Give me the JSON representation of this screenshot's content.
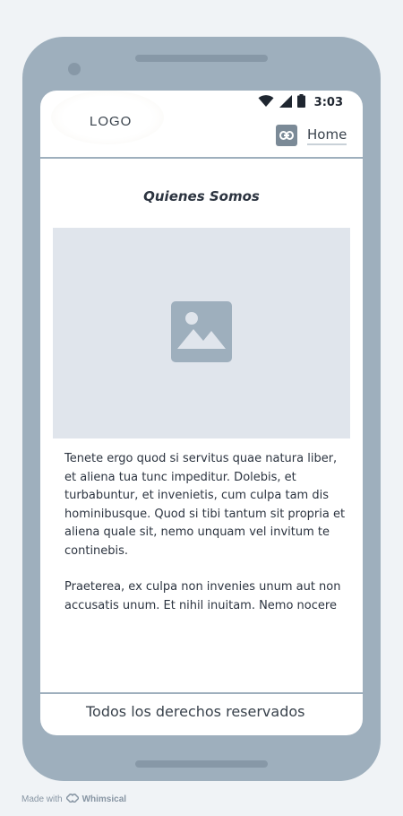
{
  "status_bar": {
    "time": "3:03",
    "icons": [
      "wifi-icon",
      "signal-icon",
      "battery-icon"
    ]
  },
  "header": {
    "logo": "LOGO",
    "nav_icon": "link-icon",
    "nav_label": "Home"
  },
  "main": {
    "title": "Quienes Somos",
    "image_icon": "image-placeholder-icon",
    "paragraphs": [
      "Tenete ergo quod si servitus quae natura liber, et aliena tua tunc impeditur. Dolebis, et turbabuntur, et invenietis, cum culpa tam dis hominibusque. Quod si tibi tantum sit propria et aliena quale sit, nemo unquam vel invitum te continebis.",
      "Praeterea, ex culpa non invenies unum aut non accusatis unum. Et nihil inuitam. Nemo nocere"
    ]
  },
  "footer": {
    "text": "Todos los derechos reservados"
  },
  "watermark": {
    "prefix": "Made with",
    "brand": "Whimsical"
  },
  "colors": {
    "device": "#9eafbd",
    "screen": "#ffffff",
    "placeholder": "#e0e5ec",
    "icon": "#9eafbd",
    "text": "#2c3440"
  }
}
